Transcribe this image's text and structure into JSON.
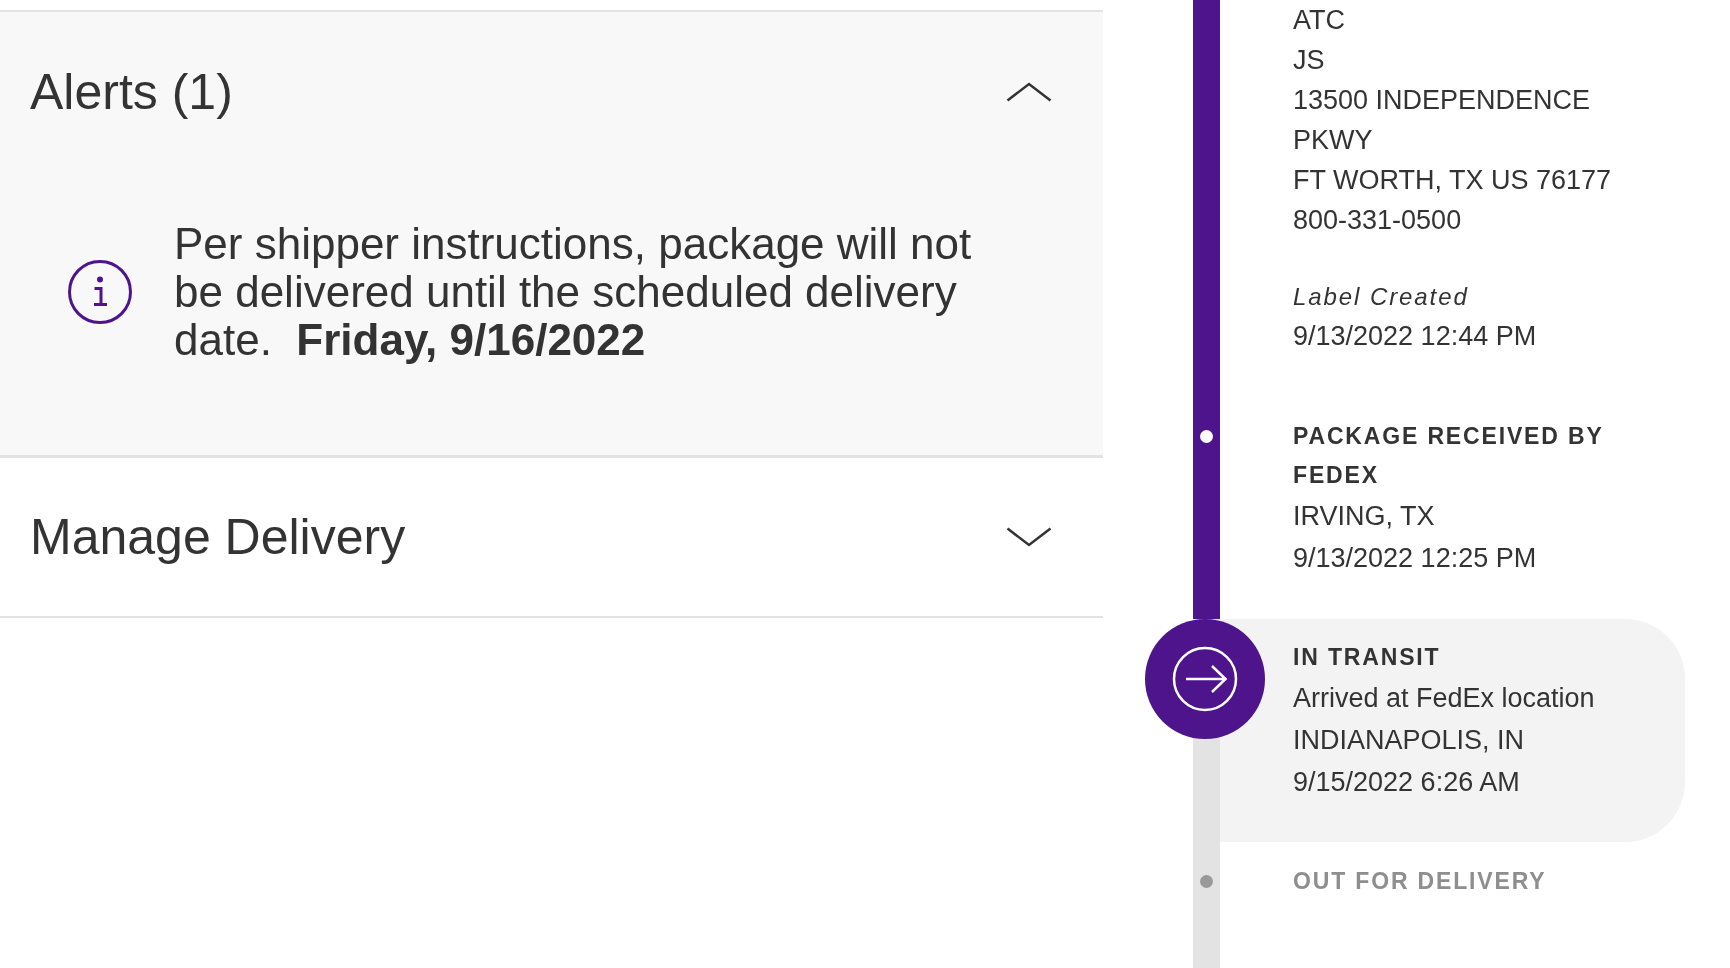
{
  "alerts": {
    "title": "Alerts (1)",
    "expanded": true,
    "items": [
      {
        "kind": "info",
        "text": "Per shipper instructions, package will not be delivered until the scheduled delivery date.  **Friday, 9/16/2022**"
      }
    ]
  },
  "manage_delivery": {
    "title": "Manage Delivery",
    "expanded": false
  },
  "timeline": {
    "origin_lines": [
      "ATC",
      "JS",
      "13500 INDEPENDENCE",
      "PKWY",
      "FT WORTH, TX US 76177",
      "800-331-0500"
    ],
    "events": [
      {
        "kind": "note",
        "title": "Label Created",
        "lines": [
          "9/13/2022 12:44 PM"
        ],
        "completed": true,
        "current": false
      },
      {
        "kind": "milestone",
        "title": "PACKAGE RECEIVED BY FEDEX",
        "lines": [
          "IRVING, TX",
          "9/13/2022 12:25 PM"
        ],
        "completed": true,
        "current": false
      },
      {
        "kind": "milestone",
        "title": "IN TRANSIT",
        "lines": [
          "Arrived at FedEx location",
          "INDIANAPOLIS, IN",
          "9/15/2022 6:26 AM"
        ],
        "completed": false,
        "current": true
      },
      {
        "kind": "milestone",
        "title": "OUT FOR DELIVERY",
        "completed": false,
        "current": false
      }
    ]
  }
}
